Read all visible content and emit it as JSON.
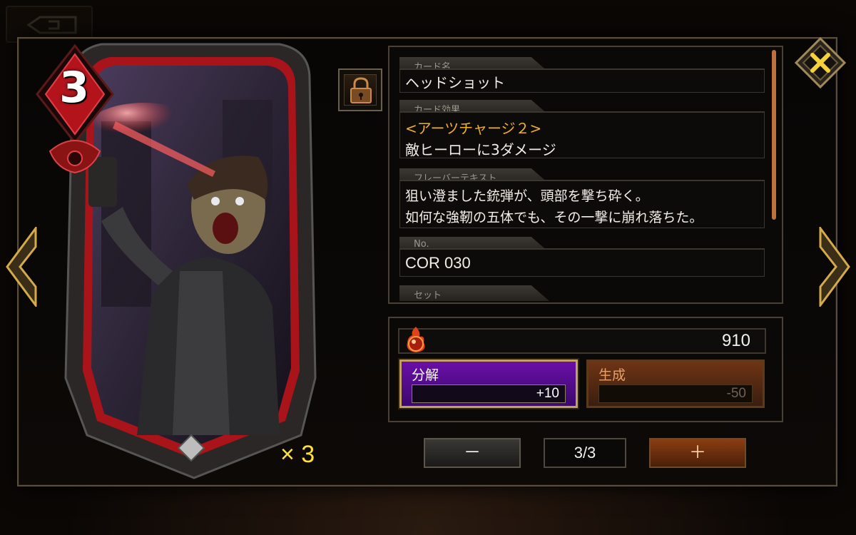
{
  "card": {
    "cost": "3",
    "copies": "× 3"
  },
  "fields": [
    {
      "label": "カード名",
      "lines": [
        "ヘッドショット"
      ]
    },
    {
      "label": "カード効果",
      "lines": [
        "<アーツチャージ２>",
        "敵ヒーローに3ダメージ"
      ]
    },
    {
      "label": "フレーバーテキスト",
      "lines": [
        "狙い澄ました銃弾が、頭部を撃ち砕く。",
        "如何な強靭の五体でも、その一撃に崩れ落ちた。"
      ]
    },
    {
      "label": "No.",
      "lines": [
        "COR 030"
      ]
    },
    {
      "label": "セット",
      "lines": []
    }
  ],
  "currency": {
    "value": "910"
  },
  "dismantle": {
    "label": "分解",
    "value": "+10"
  },
  "craft": {
    "label": "生成",
    "value": "-50"
  },
  "controls": {
    "minus": "－",
    "count": "3/3",
    "plus": "＋"
  },
  "colors": {
    "accent_gold": "#f0b12a",
    "dismantle_purple": "#6a0fa8",
    "craft_orange": "#6e3416",
    "card_red": "#c01a1a"
  },
  "icons": {
    "close": "close-x-icon",
    "prev": "chevron-left-icon",
    "next": "chevron-right-icon",
    "lock": "lock-icon",
    "currency": "fire-orb-icon",
    "back": "back-arrow-icon"
  }
}
